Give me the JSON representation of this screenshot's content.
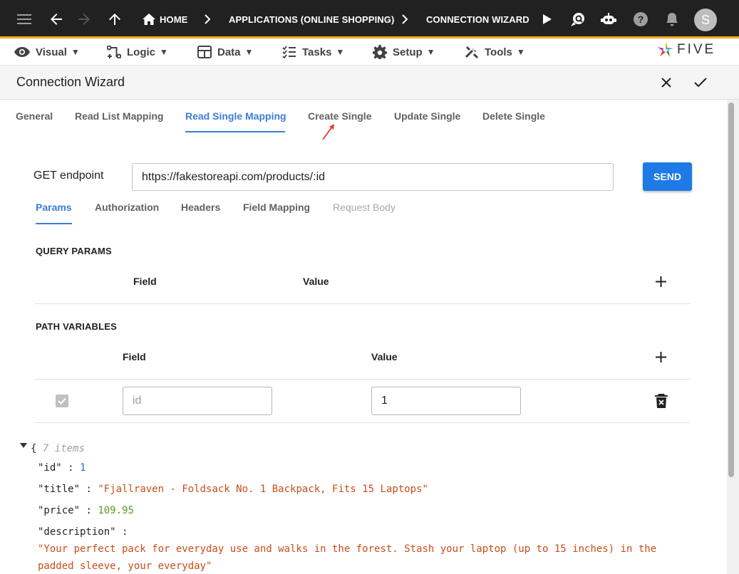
{
  "topbar": {
    "breadcrumbs": [
      {
        "label": "HOME"
      },
      {
        "label": "APPLICATIONS (ONLINE SHOPPING)"
      },
      {
        "label": "CONNECTION WIZARD"
      }
    ],
    "avatar_letter": "S",
    "icons": [
      "menu-icon",
      "back-arrow-icon",
      "forward-arrow-icon",
      "up-arrow-icon",
      "home-icon",
      "play-icon",
      "search-chat-icon",
      "robot-icon",
      "help-icon",
      "bell-icon"
    ]
  },
  "menubar": {
    "items": [
      {
        "label": "Visual",
        "icon": "eye-icon"
      },
      {
        "label": "Logic",
        "icon": "logic-icon"
      },
      {
        "label": "Data",
        "icon": "table-icon"
      },
      {
        "label": "Tasks",
        "icon": "tasks-icon"
      },
      {
        "label": "Setup",
        "icon": "gear-icon"
      },
      {
        "label": "Tools",
        "icon": "tools-icon"
      }
    ],
    "caret": "▼",
    "logo_text": "FIVE"
  },
  "header": {
    "title": "Connection Wizard"
  },
  "tabs": [
    {
      "label": "General"
    },
    {
      "label": "Read List Mapping"
    },
    {
      "label": "Read Single Mapping",
      "active": true
    },
    {
      "label": "Create Single"
    },
    {
      "label": "Update Single"
    },
    {
      "label": "Delete Single"
    }
  ],
  "endpoint": {
    "label": "GET endpoint",
    "value": "https://fakestoreapi.com/products/:id",
    "send_label": "SEND"
  },
  "subtabs": [
    {
      "label": "Params",
      "active": true
    },
    {
      "label": "Authorization"
    },
    {
      "label": "Headers"
    },
    {
      "label": "Field Mapping"
    },
    {
      "label": "Request Body",
      "disabled": true
    }
  ],
  "query_params": {
    "title": "QUERY PARAMS",
    "field_header": "Field",
    "value_header": "Value"
  },
  "path_variables": {
    "title": "PATH VARIABLES",
    "field_header": "Field",
    "value_header": "Value",
    "rows": [
      {
        "field_placeholder": "id",
        "value": "1"
      }
    ]
  },
  "json_view": {
    "open_brace": "{",
    "count_label": "7 items",
    "entries": [
      {
        "key": "\"id\"",
        "sep": " : ",
        "value": "1"
      },
      {
        "key": "\"title\"",
        "sep": " : ",
        "value": "\"Fjallraven - Foldsack No. 1 Backpack, Fits 15 Laptops\""
      },
      {
        "key": "\"price\"",
        "sep": " : ",
        "value": "109.95"
      },
      {
        "key": "\"description\"",
        "sep": " : ",
        "value_line1": "\"Your perfect pack for everyday use and walks in the forest. Stash your laptop (up to 15 inches) in the",
        "value_line2": "padded sleeve, your everyday\""
      }
    ]
  },
  "colors": {
    "topbar_bg": "#212121",
    "accent_orange": "#f2a81d",
    "active_tab": "#3b7dd8",
    "send_button": "#1e7ae6",
    "json_string": "#c94d1b",
    "json_number": "#2a6ec7"
  }
}
